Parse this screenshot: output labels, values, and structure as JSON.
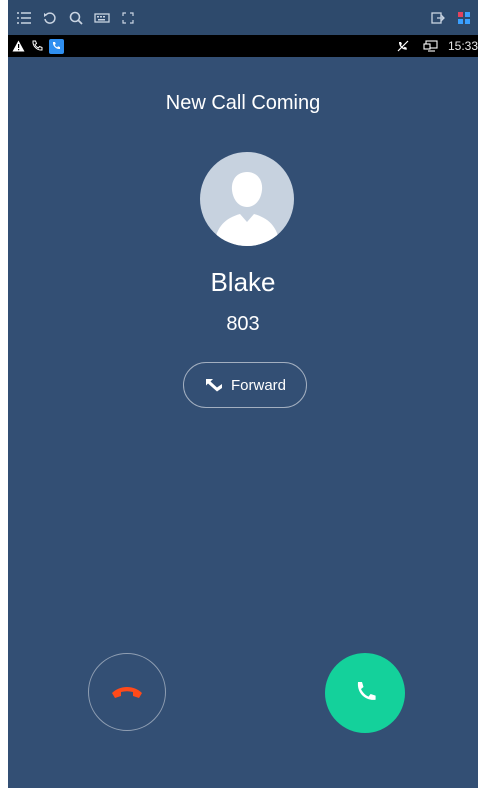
{
  "toolbar": {
    "icons": [
      "menu-icon",
      "refresh-icon",
      "zoom-icon",
      "keyboard-icon",
      "fullscreen-icon",
      "exit-icon",
      "grid-icon"
    ]
  },
  "statusbar": {
    "icons": [
      "warning-icon",
      "phone-outline-icon",
      "phone-app-icon",
      "mute-icon",
      "screen-icon"
    ],
    "time": "15:33"
  },
  "call": {
    "title": "New Call Coming",
    "caller_name": "Blake",
    "caller_number": "803",
    "forward_label": "Forward"
  },
  "colors": {
    "background": "#334f74",
    "reject": "#ff4a1a",
    "answer": "#14d19b"
  }
}
